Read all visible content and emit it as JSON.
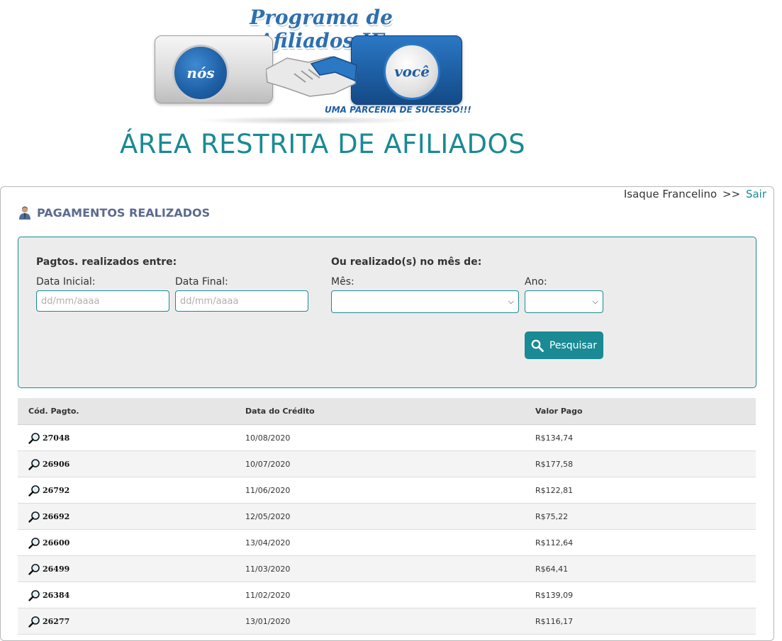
{
  "header": {
    "logo_title": "Programa de Afiliados IF",
    "logo_left_word": "nós",
    "logo_right_word": "você",
    "logo_tagline": "UMA PARCERIA DE SUCESSO!!!",
    "area_title": "ÁREA RESTRITA DE AFILIADOS"
  },
  "user_bar": {
    "user_name": "Isaque Francelino",
    "separator": ">>",
    "logout_label": "Sair"
  },
  "section": {
    "title": "PAGAMENTOS REALIZADOS",
    "icon": "user-icon"
  },
  "filters": {
    "range_label": "Pagtos. realizados entre:",
    "start_label": "Data Inicial:",
    "start_placeholder": "dd/mm/aaaa",
    "end_label": "Data Final:",
    "end_placeholder": "dd/mm/aaaa",
    "month_group_label": "Ou realizado(s) no mês de:",
    "month_label": "Mês:",
    "month_value": "",
    "year_label": "Ano:",
    "year_value": "",
    "search_label": "Pesquisar",
    "search_icon": "search-icon"
  },
  "table": {
    "columns": [
      "Cód. Pagto.",
      "Data do Crédito",
      "Valor Pago"
    ],
    "rows": [
      {
        "code": "27048",
        "date": "10/08/2020",
        "value": "R$134,74"
      },
      {
        "code": "26906",
        "date": "10/07/2020",
        "value": "R$177,58"
      },
      {
        "code": "26792",
        "date": "11/06/2020",
        "value": "R$122,81"
      },
      {
        "code": "26692",
        "date": "12/05/2020",
        "value": "R$75,22"
      },
      {
        "code": "26600",
        "date": "13/04/2020",
        "value": "R$112,64"
      },
      {
        "code": "26499",
        "date": "11/03/2020",
        "value": "R$64,41"
      },
      {
        "code": "26384",
        "date": "11/02/2020",
        "value": "R$139,09"
      },
      {
        "code": "26277",
        "date": "13/01/2020",
        "value": "R$116,17"
      }
    ]
  },
  "colors": {
    "accent": "#1a8a94",
    "brand_blue": "#1d5ea3",
    "section_title": "#5b6a8f",
    "filter_bg": "#ececec"
  }
}
